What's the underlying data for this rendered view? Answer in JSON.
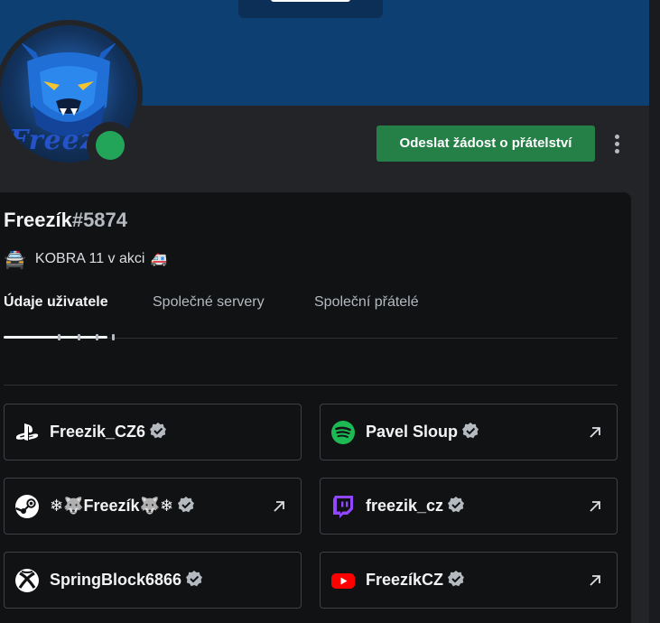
{
  "profile": {
    "name": "Freezík",
    "discriminator": "#5874",
    "avatar_text": "Freez",
    "status_emoji_left": "🚔",
    "status_text": "KOBRA 11 v akci",
    "status_emoji_right": "🚑"
  },
  "actions": {
    "friend_request_label": "Odeslat žádost o přátelství"
  },
  "tabs": [
    {
      "label": "Údaje uživatele",
      "active": true
    },
    {
      "label": "Společné servery",
      "active": false
    },
    {
      "label": "Společní přátelé",
      "active": false
    }
  ],
  "connections": [
    {
      "service": "PlayStation",
      "icon": "playstation-icon",
      "name": "Freezik_CZ6",
      "verified": true,
      "external": false
    },
    {
      "service": "Spotify",
      "icon": "spotify-icon",
      "name": "Pavel Sloup",
      "verified": true,
      "external": true
    },
    {
      "service": "Steam",
      "icon": "steam-icon",
      "name": "❄🐺Freezík🐺❄",
      "verified": true,
      "external": true
    },
    {
      "service": "Twitch",
      "icon": "twitch-icon",
      "name": "freezik_cz",
      "verified": true,
      "external": true
    },
    {
      "service": "Xbox",
      "icon": "xbox-icon",
      "name": "SpringBlock6866",
      "verified": true,
      "external": false
    },
    {
      "service": "YouTube",
      "icon": "youtube-icon",
      "name": "FreezíkCZ",
      "verified": true,
      "external": true
    }
  ],
  "colors": {
    "banner": "#0e3f73",
    "background": "#232428",
    "card": "#111214",
    "online": "#23a559",
    "button": "#248046",
    "spotify": "#1db954",
    "twitch": "#9146ff",
    "youtube": "#ff0000"
  }
}
